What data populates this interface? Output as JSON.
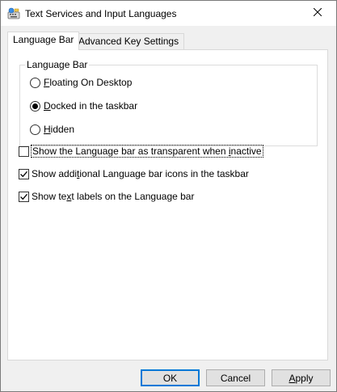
{
  "window": {
    "title": "Text Services and Input Languages",
    "close_glyph": "✕"
  },
  "tabs": [
    {
      "label": "Language Bar",
      "active": true
    },
    {
      "label": "Advanced Key Settings",
      "active": false
    }
  ],
  "language_bar_group": {
    "legend": "Language Bar",
    "options": [
      {
        "pre": "",
        "u": "F",
        "post": "loating On Desktop",
        "selected": false
      },
      {
        "pre": "",
        "u": "D",
        "post": "ocked in the taskbar",
        "selected": true
      },
      {
        "pre": "",
        "u": "H",
        "post": "idden",
        "selected": false
      }
    ]
  },
  "checkboxes": [
    {
      "pre": "Show the Language bar as transparent when ",
      "u": "i",
      "post": "nactive",
      "checked": false,
      "focused": true
    },
    {
      "pre": "Show addi",
      "u": "t",
      "post": "ional Language bar icons in the taskbar",
      "checked": true,
      "focused": false
    },
    {
      "pre": "Show te",
      "u": "x",
      "post": "t labels on the Language bar",
      "checked": true,
      "focused": false
    }
  ],
  "buttons": {
    "ok": "OK",
    "cancel": "Cancel",
    "apply_u": "A",
    "apply_rest": "pply"
  },
  "icons": {
    "app": "keyboard-globe-icon",
    "close": "close-icon"
  }
}
